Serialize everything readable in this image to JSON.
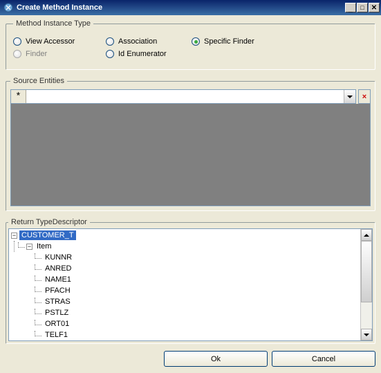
{
  "window": {
    "title": "Create Method Instance"
  },
  "groups": {
    "method_instance_type": "Method Instance Type",
    "source_entities": "Source Entities",
    "return_type_descriptor": "Return TypeDescriptor"
  },
  "radios": {
    "view_accessor": "View Accessor",
    "association": "Association",
    "specific_finder": "Specific Finder",
    "finder": "Finder",
    "id_enumerator": "Id Enumerator"
  },
  "tree": {
    "root": "CUSTOMER_T",
    "item_label": "Item",
    "children": [
      "KUNNR",
      "ANRED",
      "NAME1",
      "PFACH",
      "STRAS",
      "PSTLZ",
      "ORT01",
      "TELF1"
    ]
  },
  "buttons": {
    "ok": "Ok",
    "cancel": "Cancel"
  },
  "symbols": {
    "star": "*",
    "delete": "×",
    "minus": "−"
  }
}
